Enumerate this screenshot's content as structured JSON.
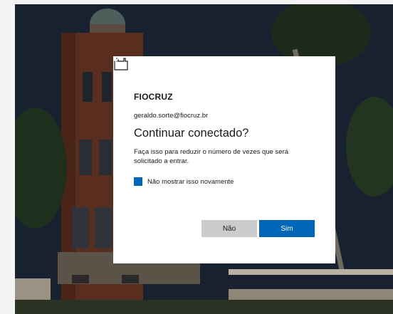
{
  "brand": {
    "logo_text": "FIOCRUZ"
  },
  "account": {
    "email": "geraldo.sorte@fiocruz.br"
  },
  "prompt": {
    "title": "Continuar conectado?",
    "description": "Faça isso para reduzir o número de vezes que será solicitado a entrar.",
    "checkbox_label": "Não mostrar isso novamente",
    "checkbox_checked": true
  },
  "buttons": {
    "no_label": "Não",
    "yes_label": "Sim"
  },
  "colors": {
    "primary": "#0067b8",
    "secondary_button": "#cccccc"
  }
}
